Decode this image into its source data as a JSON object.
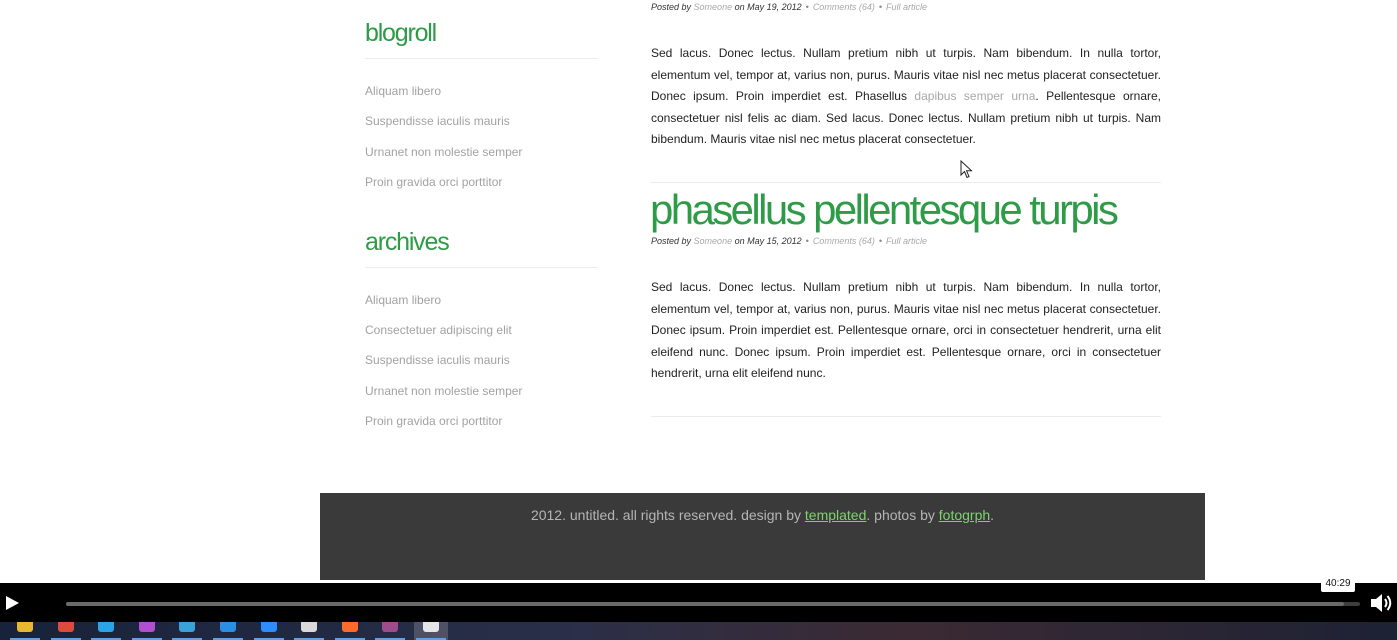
{
  "sidebar": {
    "blogroll": {
      "heading": "blogroll",
      "links": [
        "Aliquam libero",
        "Suspendisse iaculis mauris",
        "Urnanet non molestie semper",
        "Proin gravida orci porttitor"
      ]
    },
    "archives": {
      "heading": "archives",
      "links": [
        "Aliquam libero",
        "Consectetuer adipiscing elit",
        "Suspendisse iaculis mauris",
        "Urnanet non molestie semper",
        "Proin gravida orci porttitor"
      ]
    }
  },
  "posts": [
    {
      "meta": {
        "posted_by": "Posted by",
        "author": "Someone",
        "on_date": "on May 19, 2012",
        "comments": "Comments (64)",
        "full_article": "Full article"
      },
      "body_before_link": "Sed lacus. Donec lectus. Nullam pretium nibh ut turpis. Nam bibendum. In nulla tortor, elementum vel, tempor at, varius non, purus. Mauris vitae nisl nec metus placerat consectetuer. Donec ipsum. Proin imperdiet est. Phasellus ",
      "body_link": "dapibus semper urna",
      "body_after_link": ". Pellentesque ornare, consectetuer nisl felis ac diam. Sed lacus. Donec lectus. Nullam pretium nibh ut turpis. Nam bibendum. Mauris vitae nisl nec metus placerat consectetuer."
    },
    {
      "title": "phasellus pellentesque turpis",
      "meta": {
        "posted_by": "Posted by",
        "author": "Someone",
        "on_date": "on May 15, 2012",
        "comments": "Comments (64)",
        "full_article": "Full article"
      },
      "body": "Sed lacus. Donec lectus. Nullam pretium nibh ut turpis. Nam bibendum. In nulla tortor, elementum vel, tempor at, varius non, purus. Mauris vitae nisl nec metus placerat consectetuer. Donec ipsum. Proin imperdiet est. Pellentesque ornare, orci in consectetuer hendrerit, urna elit eleifend nunc. Donec ipsum. Proin imperdiet est. Pellentesque ornare, orci in consectetuer hendrerit, urna elit eleifend nunc."
    }
  ],
  "footer": {
    "text_before": "2012. untitled. all rights reserved. design by ",
    "link1": "templated",
    "text_middle": ". photos by ",
    "link2": "fotogrph",
    "text_after": "."
  },
  "player": {
    "time_tooltip": "40:29",
    "progress_fraction": 0.988,
    "play_icon": "play-icon",
    "volume_icon": "volume-icon"
  },
  "taskbar": {
    "icons": [
      {
        "name": "file-explorer-icon",
        "color": "#e8b830"
      },
      {
        "name": "chrome-icon",
        "color": "#de4b3a"
      },
      {
        "name": "photoshop-icon",
        "color": "#2aa3e8"
      },
      {
        "name": "premiere-icon",
        "color": "#b24fcf"
      },
      {
        "name": "store-icon",
        "color": "#38a3d8"
      },
      {
        "name": "vscode-icon",
        "color": "#2a8fe0"
      },
      {
        "name": "zoom-icon",
        "color": "#2d8cff"
      },
      {
        "name": "paint-icon",
        "color": "#d9d9d9"
      },
      {
        "name": "firefox-icon",
        "color": "#ff6b2b"
      },
      {
        "name": "media-icon",
        "color": "#9e4c8e"
      },
      {
        "name": "photos-icon",
        "color": "#e6e6e6"
      }
    ],
    "active_index": 10
  }
}
